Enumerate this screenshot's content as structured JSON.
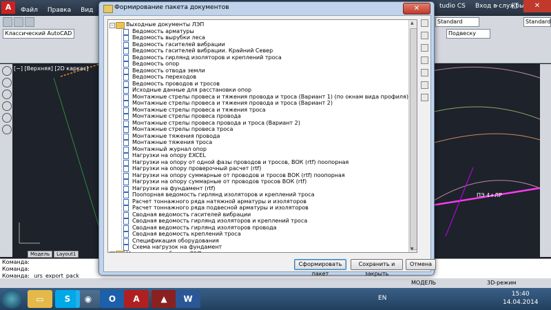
{
  "autocad": {
    "menu": [
      "Файл",
      "Правка",
      "Вид"
    ],
    "title_fragment": "tudio CS",
    "login": "Вход в службы",
    "workspace": "Классический AutoCAD",
    "style_combo": "Standard",
    "style_combo2": "Standard",
    "layer_combo": "Подвеску",
    "viewport_label": "[−] [Верхняя] [2D каркас]",
    "tabs": [
      "Модель",
      "Layout1"
    ],
    "command_lines": [
      "Команда:",
      "Команда:",
      "Команда: _urs_export_pack"
    ],
    "status_model": "МОДЕЛЬ",
    "status_3d": "3D-режим",
    "canvas_text": "ПЭ 4+ЛР"
  },
  "dialog": {
    "title": "Формирование пакета документов",
    "close_glyph": "✕",
    "root_folder": "Выходные документы ЛЭП",
    "items": [
      "Ведомость арматуры",
      "Ведомость вырубки леса",
      "Ведомость гасителей вибрации",
      "Ведомость гасителей вибрации. Крайний Север",
      "Ведомость гирлянд изоляторов и креплений троса",
      "Ведомость опор",
      "Ведомость отвода земли",
      "Ведомость переходов",
      "Ведомость проводов и тросов",
      "Исходные данные для расстановки опор",
      "Монтажные стрелы провеса и тяжения провода и троса (Вариант 1) (по окнам вида профиля)",
      "Монтажные стрелы провеса и тяжения провода и троса (Вариант 2)",
      "Монтажные стрелы провеса и тяжения троса",
      "Монтажные стрелы провеса провода",
      "Монтажные стрелы провеса провода и троса (Вариант 2)",
      "Монтажные стрелы провеса троса",
      "Монтажные тяжения провода",
      "Монтажные тяжения троса",
      "Монтажный журнал опор",
      "Нагрузки на опору EXCEL",
      "Нагрузки на опору от одной фазы проводов и тросов, ВОК (rtf) поопорная",
      "Нагрузки на опору проверочный расчет (rtf)",
      "Нагрузки на опору суммарные от проводов и тросов ВОК (rtf) поопорная",
      "Нагрузки на опору суммарные от проводов тросов ВОК (rtf)",
      "Нагрузки на фундамент (rtf)",
      "Поопорная ведомость гирлянд изоляторов и креплений троса",
      "Расчет тоннажного ряда натяжной арматуры и изоляторов",
      "Расчет тоннажного ряда подвесной арматуры и изоляторов",
      "Сводная ведомость гасителей вибрации",
      "Сводная ведомость гирлянд изоляторов и креплений троса",
      "Сводная ведомость гирлянд изоляторов провода",
      "Сводная ведомость креплений троса",
      "Спецификация оборудования",
      "Схема нагрузок на фундамент"
    ],
    "second_folder": "Монтажные таблицы ЛЭП",
    "buttons": {
      "generate": "Сформировать пакет",
      "save_close": "Сохранить и закрыть",
      "cancel": "Отмена"
    }
  },
  "taskbar": {
    "lang": "EN",
    "time": "15:40",
    "date": "14.04.2014"
  }
}
